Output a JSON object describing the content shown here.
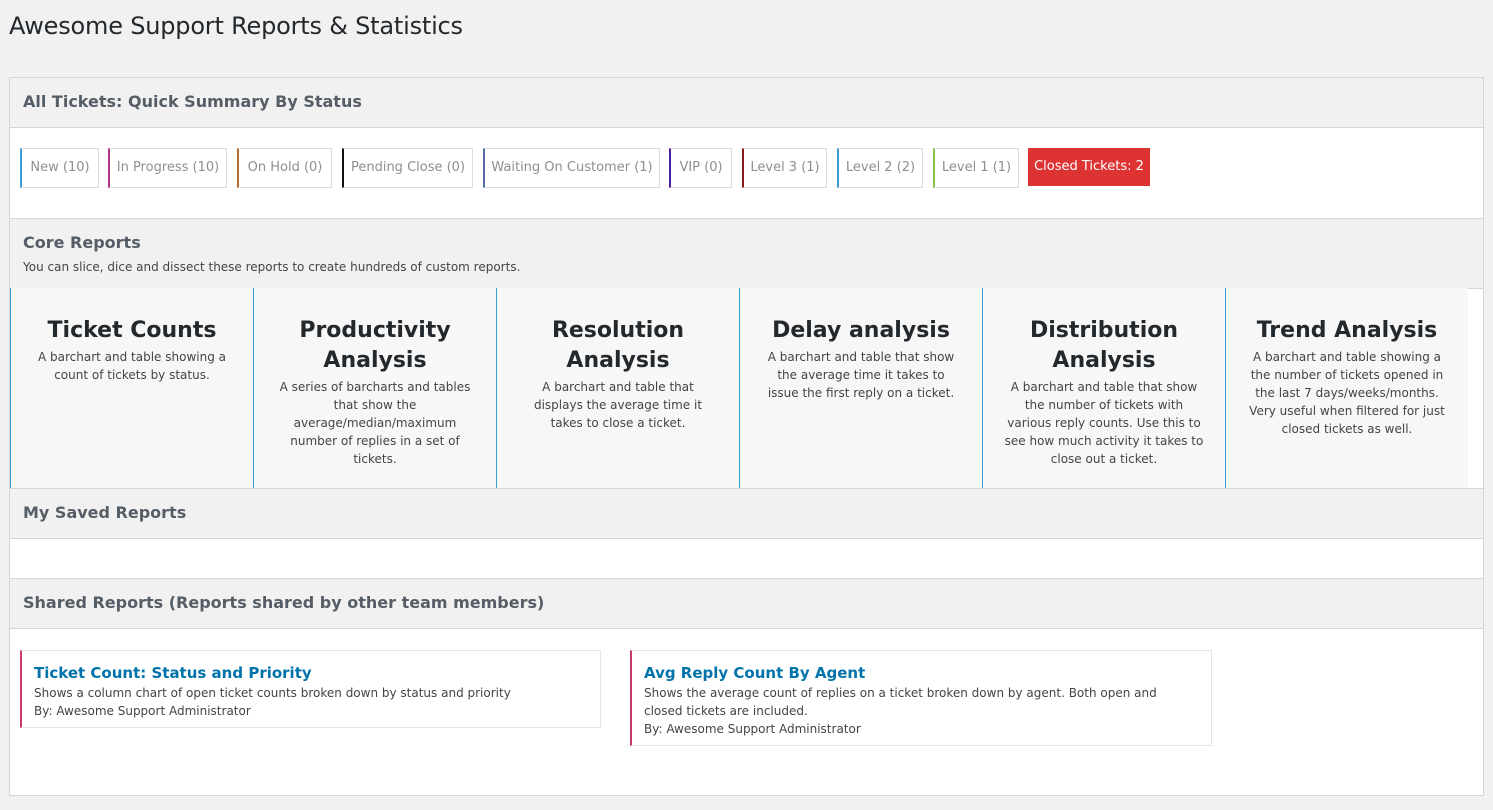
{
  "page": {
    "title": "Awesome Support Reports & Statistics"
  },
  "summary": {
    "heading": "All Tickets: Quick Summary By Status",
    "statuses": [
      {
        "label": "New (10)",
        "color": "#3a9bd6"
      },
      {
        "label": "In Progress (10)",
        "color": "#b5358c"
      },
      {
        "label": "On Hold (0)",
        "color": "#b36b2a"
      },
      {
        "label": "Pending Close (0)",
        "color": "#111111"
      },
      {
        "label": "Waiting On Customer (1)",
        "color": "#5a6aa8"
      },
      {
        "label": "VIP (0)",
        "color": "#4b1ba1"
      },
      {
        "label": "Level 3 (1)",
        "color": "#8b1a1a"
      },
      {
        "label": "Level 2 (2)",
        "color": "#3a9bd6"
      },
      {
        "label": "Level 1 (1)",
        "color": "#8bc34a"
      }
    ],
    "closed_label": "Closed Tickets: 2",
    "closed_color": "#dd3333"
  },
  "core": {
    "heading": "Core Reports",
    "subheading": "You can slice, dice and dissect these reports to create hundreds of custom reports.",
    "reports": [
      {
        "title": "Ticket Counts",
        "desc": "A barchart and table showing a count of tickets by status."
      },
      {
        "title": "Productivity Analysis",
        "desc": "A series of barcharts and tables that show the average/median/maximum number of replies in a set of tickets."
      },
      {
        "title": "Resolution Analysis",
        "desc": "A barchart and table that displays the average time it takes to close a ticket."
      },
      {
        "title": "Delay analysis",
        "desc": "A barchart and table that show the average time it takes to issue the first reply on a ticket."
      },
      {
        "title": "Distribution Analysis",
        "desc": "A barchart and table that show the number of tickets with various reply counts. Use this to see how much activity it takes to close out a ticket."
      },
      {
        "title": "Trend Analysis",
        "desc": "A barchart and table showing a the number of tickets opened in the last 7 days/weeks/months. Very useful when filtered for just closed tickets as well."
      }
    ]
  },
  "saved": {
    "heading": "My Saved Reports"
  },
  "shared": {
    "heading": "Shared Reports (Reports shared by other team members)",
    "reports": [
      {
        "title": "Ticket Count: Status and Priority",
        "desc": "Shows a column chart of open ticket counts broken down by status and priority",
        "by": "By: Awesome Support Administrator"
      },
      {
        "title": "Avg Reply Count By Agent",
        "desc": "Shows the average count of replies on a ticket broken down by agent. Both open and closed tickets are included.",
        "by": "By: Awesome Support Administrator"
      }
    ]
  }
}
